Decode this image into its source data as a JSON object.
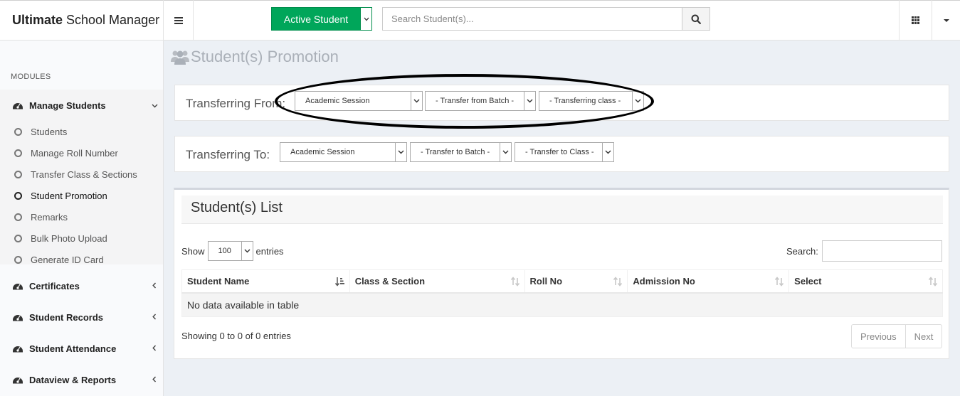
{
  "header": {
    "brand_bold": "Ultimate",
    "brand_rest": "School Manager",
    "active_button_label": "Active Student",
    "search_placeholder": "Search Student(s)..."
  },
  "sidebar": {
    "modules_label": "MODULES",
    "menus": [
      {
        "label": "Manage Students",
        "expanded": true
      },
      {
        "label": "Certificates",
        "expanded": false
      },
      {
        "label": "Student Records",
        "expanded": false
      },
      {
        "label": "Student Attendance",
        "expanded": false
      },
      {
        "label": "Dataview & Reports",
        "expanded": false
      }
    ],
    "sub_items": [
      "Students",
      "Manage Roll Number",
      "Transfer Class & Sections",
      "Student Promotion",
      "Remarks",
      "Bulk Photo Upload",
      "Generate ID Card"
    ],
    "current_sub_item": "Student Promotion"
  },
  "page": {
    "title": "Student(s) Promotion"
  },
  "transfer_from": {
    "label": "Transferring From:",
    "session": "Academic Session",
    "batch": "- Transfer from Batch -",
    "class": "- Transferring class -"
  },
  "transfer_to": {
    "label": "Transferring To:",
    "session": "Academic Session",
    "batch": "- Transfer to Batch -",
    "class": "- Transfer to Class -"
  },
  "student_list": {
    "title": "Student(s) List",
    "show_label": "Show",
    "entries_value": "100",
    "entries_label": "entries",
    "search_label": "Search:",
    "columns": [
      "Student Name",
      "Class & Section",
      "Roll No",
      "Admission No",
      "Select"
    ],
    "empty_message": "No data available in table",
    "info": "Showing 0 to 0 of 0 entries",
    "prev_label": "Previous",
    "next_label": "Next"
  },
  "colors": {
    "accent_green": "#00a65a",
    "content_bg": "#ecf0f5"
  }
}
